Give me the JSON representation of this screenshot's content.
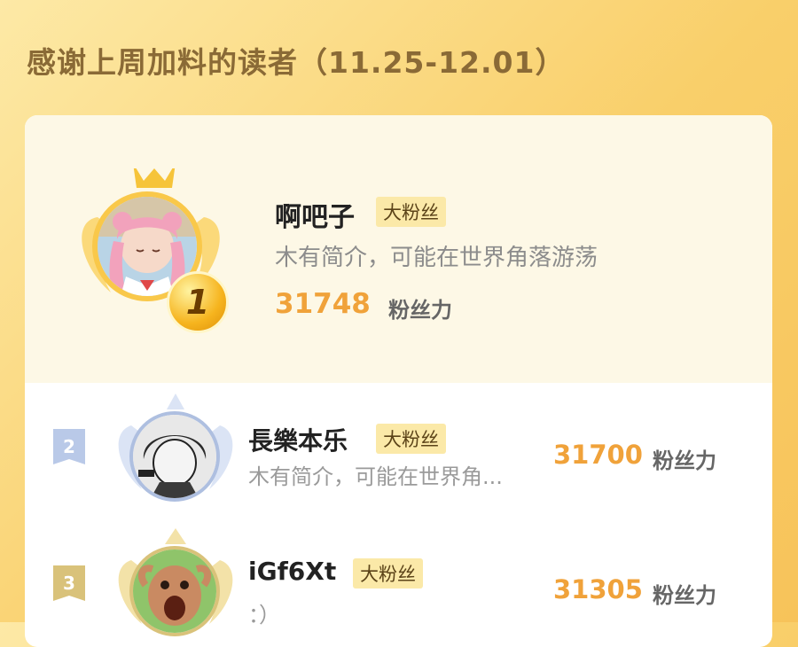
{
  "title": "感谢上周加料的读者（11.25-12.01）",
  "colors": {
    "accent": "#f0a23a",
    "badge_bg": "#fbe9a8",
    "gold": "#f9c84a",
    "silver": "#aebfe0",
    "bronze": "#d9c27a"
  },
  "first": {
    "rank": "1",
    "name": "啊吧子",
    "badge": "大粉丝",
    "bio": "木有简介，可能在世界角落游荡",
    "score": "31748",
    "score_unit": "粉丝力"
  },
  "rows": [
    {
      "rank": "2",
      "name": "長樂本乐",
      "badge": "大粉丝",
      "bio": "木有简介，可能在世界角...",
      "score": "31700",
      "score_unit": "粉丝力"
    },
    {
      "rank": "3",
      "name": "iGf6Xt",
      "badge": "大粉丝",
      "bio": "：）",
      "score": "31305",
      "score_unit": "粉丝力"
    }
  ]
}
